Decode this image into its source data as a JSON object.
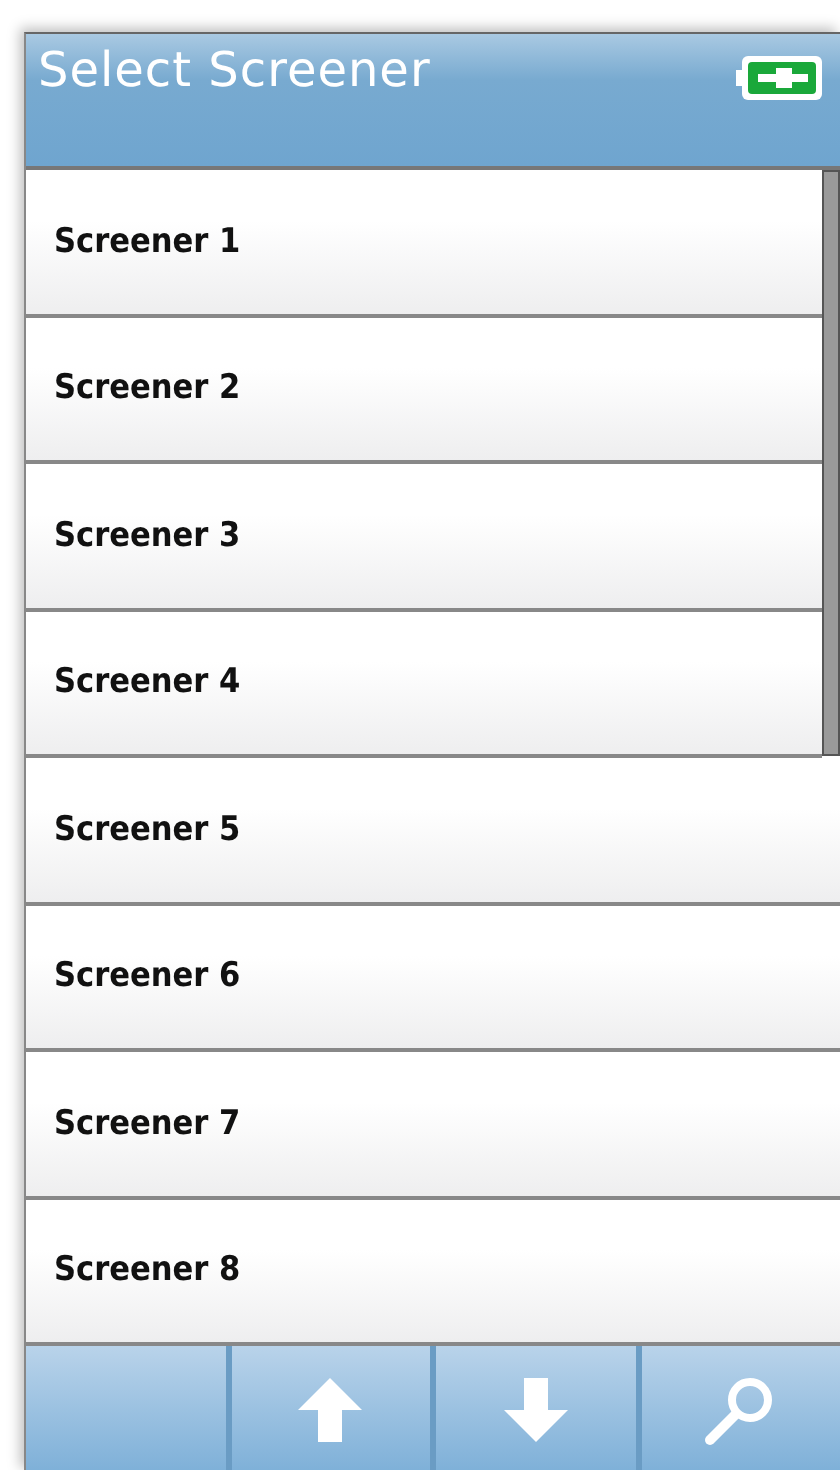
{
  "header": {
    "title": "Select Screener"
  },
  "items": [
    {
      "label": "Screener 1"
    },
    {
      "label": "Screener 2"
    },
    {
      "label": "Screener 3"
    },
    {
      "label": "Screener 4"
    },
    {
      "label": "Screener 5"
    },
    {
      "label": "Screener 6"
    },
    {
      "label": "Screener 7"
    },
    {
      "label": "Screener 8"
    }
  ],
  "toolbar": [
    {
      "kind": "blank"
    },
    {
      "kind": "up"
    },
    {
      "kind": "down"
    },
    {
      "kind": "search"
    }
  ]
}
